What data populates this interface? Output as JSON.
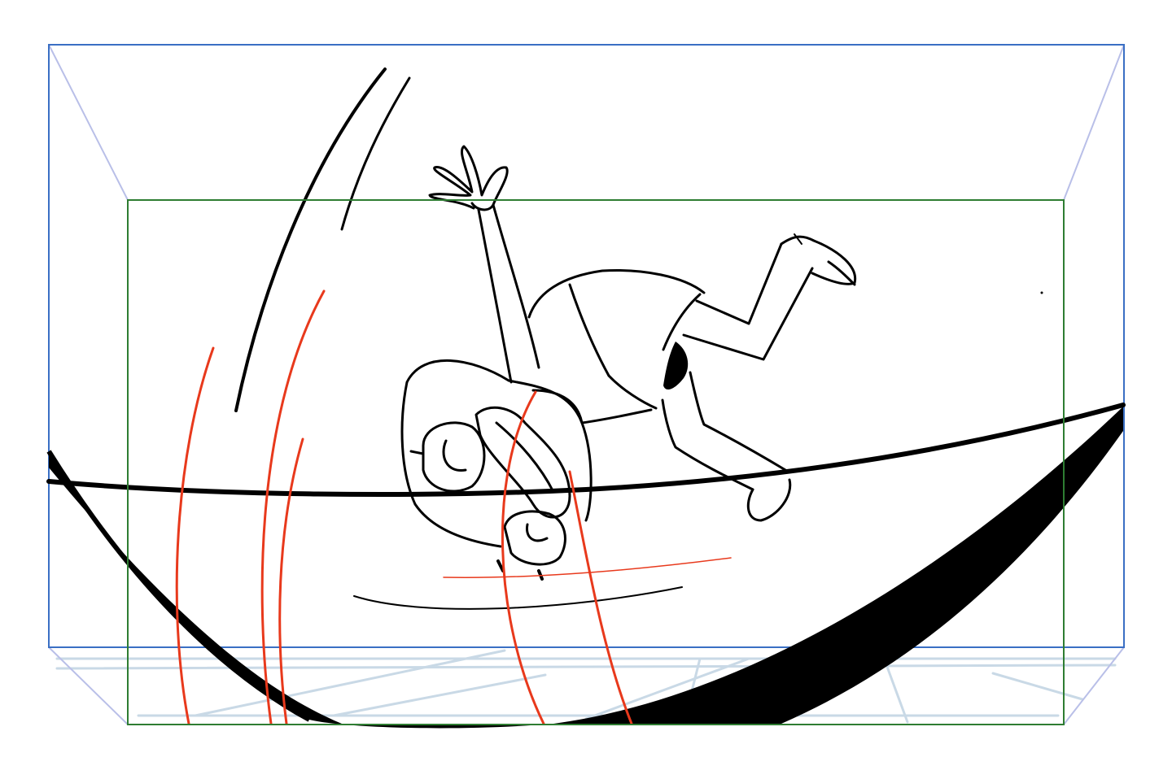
{
  "panel": {
    "background": "#ffffff"
  },
  "colors": {
    "outer_frame": "#3a6fc4",
    "outer_frame_bevel": "#b9bfe8",
    "inner_frame": "#2e7d32",
    "ink": "#000000",
    "motion_lines": "#e8391c",
    "floor_grid": "#c9d9e6"
  },
  "layers": [
    {
      "name": "camera-frame-outer"
    },
    {
      "name": "camera-frame-inner"
    },
    {
      "name": "floor-grid"
    },
    {
      "name": "character-sketch"
    },
    {
      "name": "motion-lines"
    },
    {
      "name": "tightrope"
    },
    {
      "name": "ground-shadow"
    }
  ]
}
